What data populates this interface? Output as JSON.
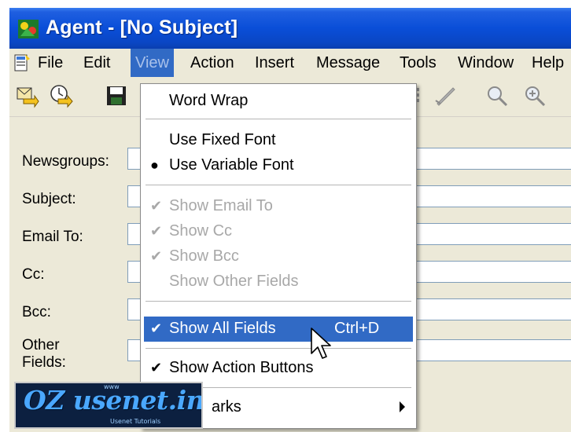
{
  "window": {
    "title": "Agent - [No Subject]"
  },
  "menubar": {
    "items": [
      "File",
      "Edit",
      "View",
      "Action",
      "Insert",
      "Message",
      "Tools",
      "Window",
      "Help"
    ],
    "active": "View"
  },
  "toolbar": {
    "buttons": [
      "send-icon",
      "send-later-icon",
      "save-icon",
      "attach-icon",
      "spell-check-icon",
      "find-icon",
      "zoom-icon"
    ]
  },
  "form": {
    "fields": [
      {
        "label": "Newsgroups:",
        "value": ""
      },
      {
        "label": "Subject:",
        "value": ""
      },
      {
        "label": "Email To:",
        "value": ""
      },
      {
        "label": "Cc:",
        "value": ""
      },
      {
        "label": "Bcc:",
        "value": ""
      },
      {
        "label": "Other Fields:",
        "value": ""
      }
    ],
    "other_line1": "Other",
    "other_line2": "Fields:"
  },
  "view_menu": {
    "items": [
      {
        "label": "Word Wrap",
        "state": "none",
        "enabled": true
      },
      {
        "label": "Use Fixed Font",
        "state": "none",
        "enabled": true
      },
      {
        "label": "Use Variable Font",
        "state": "radio",
        "enabled": true
      },
      {
        "label": "Show Email To",
        "state": "check",
        "enabled": false
      },
      {
        "label": "Show Cc",
        "state": "check",
        "enabled": false
      },
      {
        "label": "Show Bcc",
        "state": "check",
        "enabled": false
      },
      {
        "label": "Show Other Fields",
        "state": "none",
        "enabled": false
      },
      {
        "label": "Show All Fields",
        "state": "check",
        "enabled": true,
        "shortcut": "Ctrl+D",
        "highlighted": true
      },
      {
        "label": "Show Action Buttons",
        "state": "check",
        "enabled": true
      },
      {
        "label": "Bookmarks",
        "state": "none",
        "enabled": true,
        "submenu": true,
        "visible_text": "arks"
      }
    ]
  },
  "watermark": {
    "text": "OZ usenet.info",
    "small_top": "www",
    "small_bottom": "Usenet Tutorials"
  },
  "colors": {
    "title_bar": "#0a4ed8",
    "menu_highlight": "#316ac5",
    "chrome": "#ece9d8",
    "disabled_text": "#a8a8a8"
  }
}
